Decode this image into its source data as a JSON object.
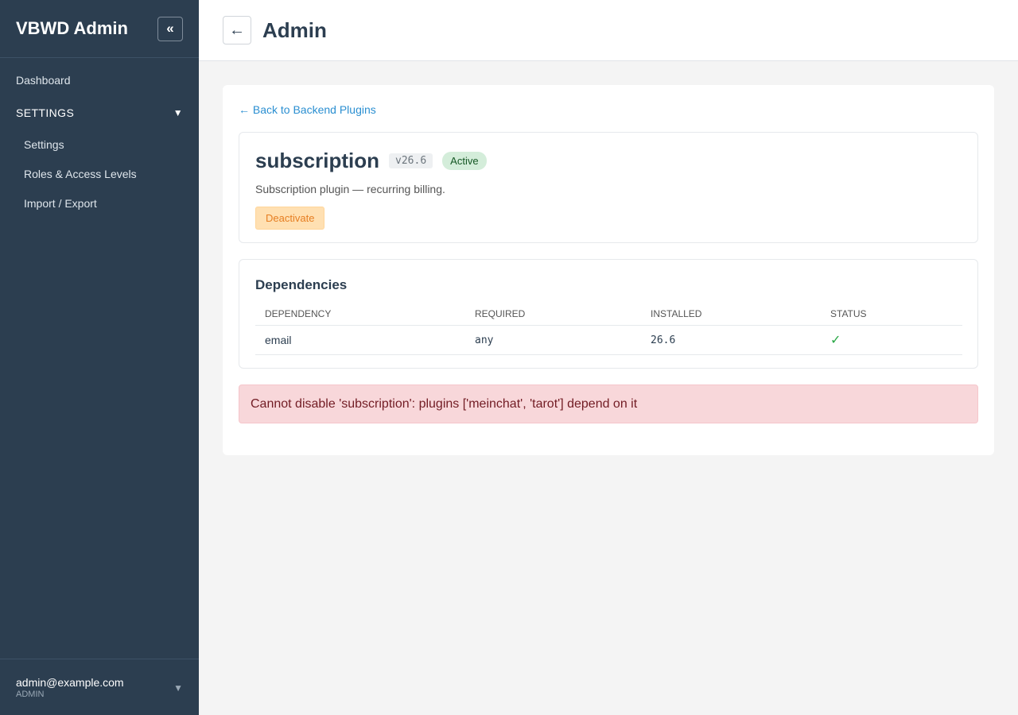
{
  "sidebar": {
    "brand": "VBWD Admin",
    "collapse_icon": "«",
    "items": [
      {
        "label": "Dashboard"
      }
    ],
    "section": {
      "label": "SETTINGS",
      "arrow": "▼",
      "children": [
        {
          "label": "Settings"
        },
        {
          "label": "Roles & Access Levels"
        },
        {
          "label": "Import / Export"
        }
      ]
    },
    "user": {
      "email": "admin@example.com",
      "role": "ADMIN",
      "toggle": "▼"
    }
  },
  "header": {
    "back_icon": "←",
    "title": "Admin"
  },
  "main": {
    "back_link": "← Back to Backend Plugins",
    "plugin": {
      "name": "subscription",
      "version": "v26.6",
      "status": "Active",
      "description": "Subscription plugin — recurring billing.",
      "action_label": "Deactivate"
    },
    "dependencies": {
      "title": "Dependencies",
      "columns": [
        "DEPENDENCY",
        "REQUIRED",
        "INSTALLED",
        "STATUS"
      ],
      "rows": [
        {
          "dependency": "email",
          "required": "any",
          "installed": "26.6",
          "status": "✓"
        }
      ]
    },
    "error": "Cannot disable 'subscription': plugins ['meinchat', 'tarot'] depend on it"
  },
  "colors": {
    "sidebar_bg": "#2c3e50",
    "link": "#2b8fd1",
    "active_badge": "#d4edda",
    "deactivate": "#ffe0b2",
    "error_bg": "#f8d7da",
    "error_text": "#721c24"
  }
}
